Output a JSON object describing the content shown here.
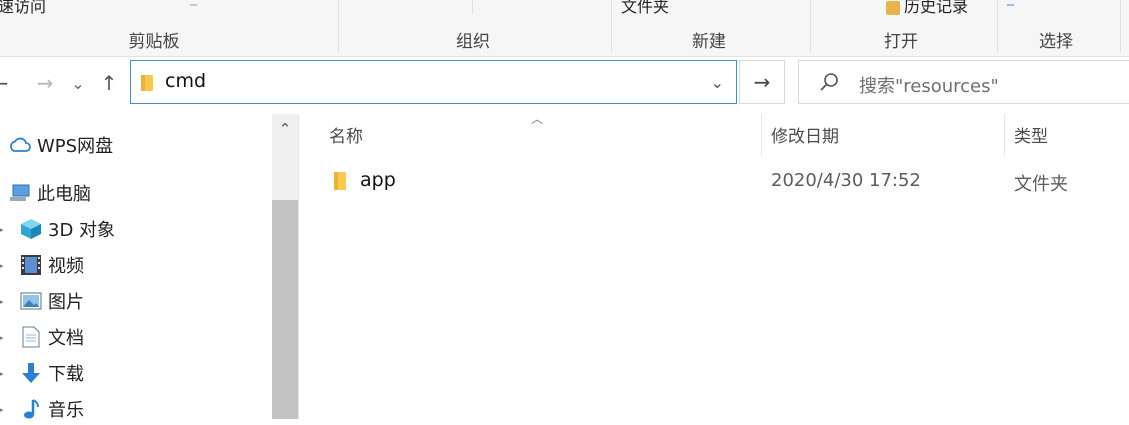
{
  "ribbon": {
    "top_items": {
      "quick_access_fragment": "速访问",
      "folder_fragment": "文件夹",
      "history_fragment": "历史记录"
    },
    "groups": {
      "clipboard": "剪贴板",
      "organize": "组织",
      "new": "新建",
      "open": "打开",
      "select": "选择"
    }
  },
  "nav": {
    "back": "←",
    "forward": "→",
    "recent": "⌄",
    "up": "↑",
    "address": "cmd",
    "go": "→",
    "search_placeholder": "搜索\"resources\""
  },
  "sidebar": {
    "items": [
      {
        "label": "WPS网盘",
        "icon": "cloud-icon"
      },
      {
        "label": "此电脑",
        "icon": "computer-icon"
      },
      {
        "label": "3D 对象",
        "icon": "cube-3d-icon"
      },
      {
        "label": "视频",
        "icon": "video-icon"
      },
      {
        "label": "图片",
        "icon": "pictures-icon"
      },
      {
        "label": "文档",
        "icon": "document-icon"
      },
      {
        "label": "下载",
        "icon": "download-icon"
      },
      {
        "label": "音乐",
        "icon": "music-icon"
      }
    ]
  },
  "content": {
    "columns": {
      "name": "名称",
      "modified": "修改日期",
      "type": "类型"
    },
    "rows": [
      {
        "name": "app",
        "modified": "2020/4/30 17:52",
        "type": "文件夹",
        "icon": "folder-icon"
      }
    ]
  },
  "colors": {
    "accent": "#3c8fd8",
    "folder": "#f8c94d",
    "selection_border": "#3c8fd8"
  }
}
